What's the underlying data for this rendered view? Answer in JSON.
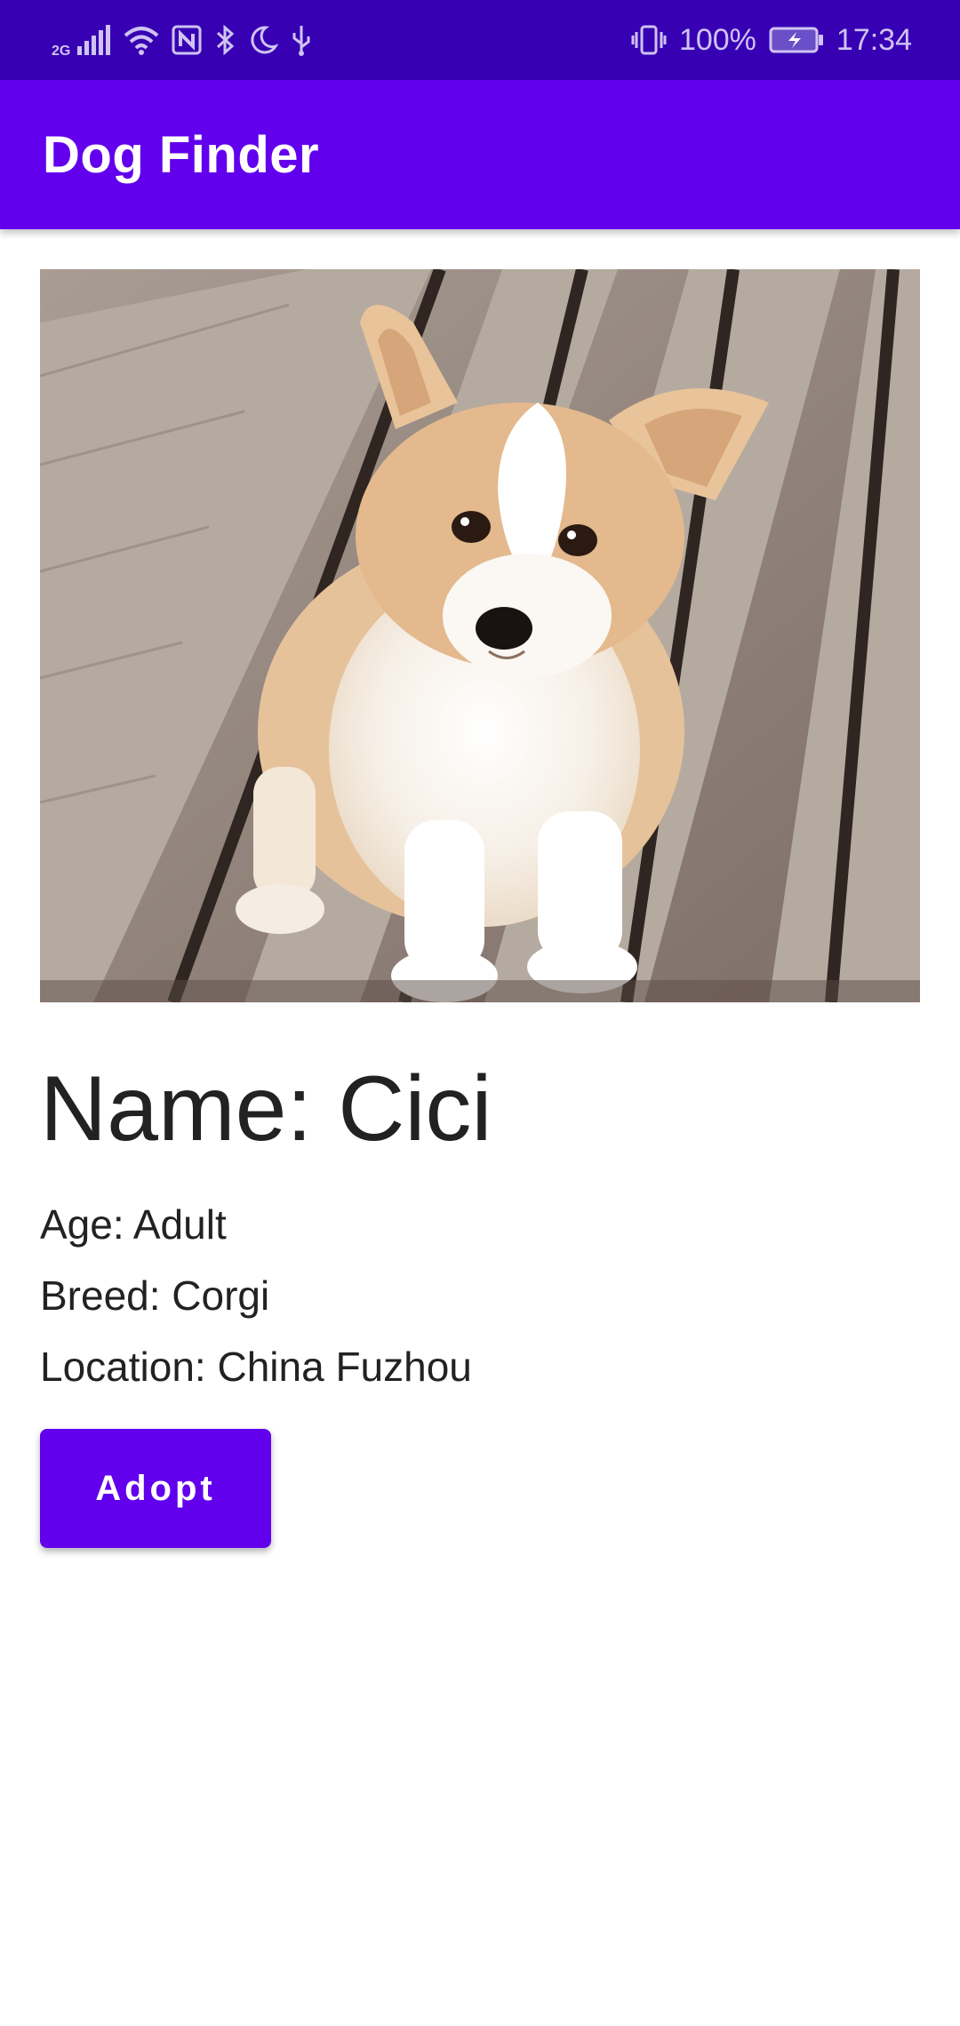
{
  "status_bar": {
    "network_type": "2G",
    "battery_percent": "100%",
    "time": "17:34",
    "icons": [
      "signal-icon",
      "wifi-icon",
      "nfc-icon",
      "bluetooth-icon",
      "do-not-disturb-icon",
      "usb-icon",
      "vibrate-icon",
      "battery-charging-icon"
    ]
  },
  "app_bar": {
    "title": "Dog Finder"
  },
  "dog": {
    "photo_alt": "corgi puppy on wooden bench",
    "name": "Name: Cici",
    "age": "Age: Adult",
    "breed": "Breed: Corgi",
    "location": "Location: China Fuzhou"
  },
  "actions": {
    "adopt_label": "Adopt"
  },
  "colors": {
    "status_bar": "#3700b3",
    "primary": "#6200ee",
    "text": "#222222"
  }
}
